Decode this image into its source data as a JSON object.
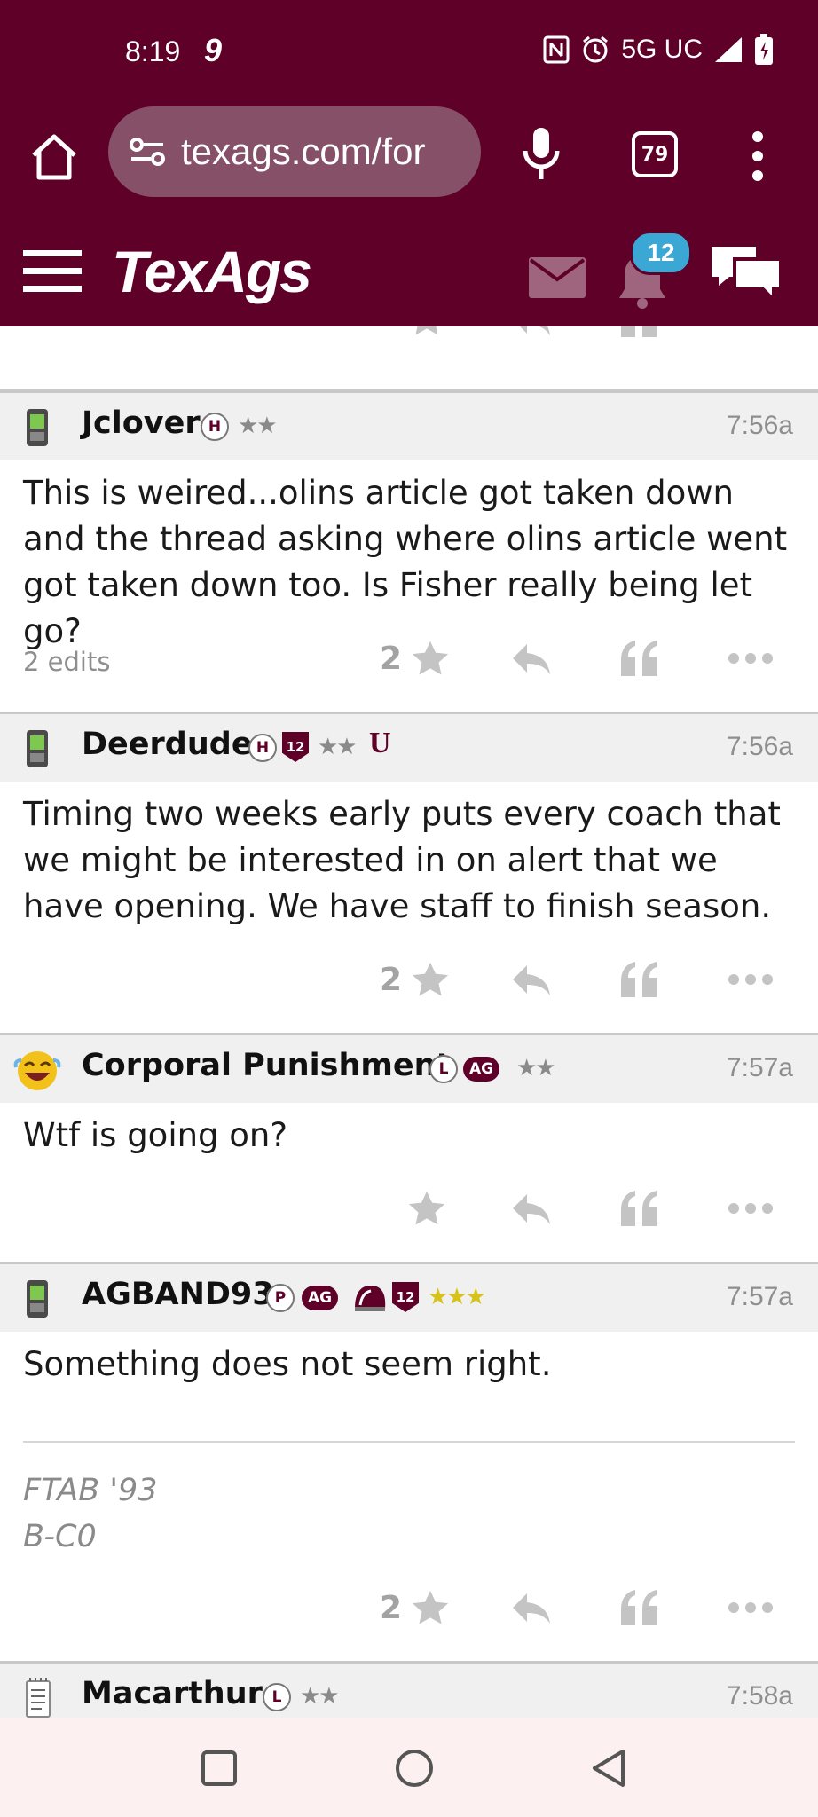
{
  "status_bar": {
    "time": "8:19",
    "carrier_icon": "9",
    "network": "5G UC",
    "icons": [
      "nfc-icon",
      "alarm-icon",
      "signal-icon",
      "battery-charging-icon"
    ]
  },
  "browser": {
    "url": "texags.com/for",
    "tab_count": "79"
  },
  "site_header": {
    "logo": "TexAgs",
    "notification_count": "12"
  },
  "posts": [
    {
      "author": "Jclover",
      "badges": [
        "H"
      ],
      "stars": "★★",
      "time": "7:56a",
      "body": "This is weired...olins article got taken down and the thread asking where olins article went got taken down too. Is Fisher really being let go?",
      "edits": "2 edits",
      "star_count": "2"
    },
    {
      "author": "Deerdude",
      "badges": [
        "H",
        "12"
      ],
      "stars": "★★",
      "extra_badge": "U",
      "time": "7:56a",
      "body": "Timing two weeks early puts every coach that we might be interested in on alert that we have opening. We have staff to finish season.",
      "star_count": "2"
    },
    {
      "author": "Corporal Punishment",
      "badges": [
        "L",
        "AG"
      ],
      "stars": "★★",
      "time": "7:57a",
      "body": "Wtf is going on?",
      "star_count": ""
    },
    {
      "author": "AGBAND93",
      "badges": [
        "P",
        "AG",
        "12"
      ],
      "stars": "★★★",
      "time": "7:57a",
      "body": "Something does not seem right.",
      "signature": [
        "FTAB '93",
        "B-C0"
      ],
      "star_count": "2"
    },
    {
      "author": "Macarthur",
      "badges": [
        "L"
      ],
      "stars": "★★",
      "time": "7:58a"
    }
  ],
  "colors": {
    "maroon": "#5e0027",
    "badge_blue": "#3aa7d4",
    "action_gray": "#c4c4c4",
    "gold_star": "#d7c21a"
  }
}
